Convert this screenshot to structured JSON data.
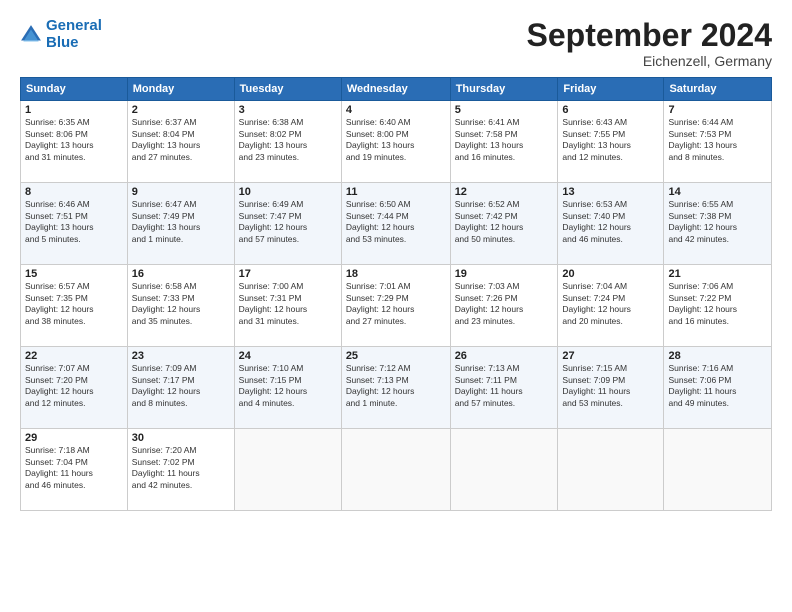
{
  "header": {
    "logo_line1": "General",
    "logo_line2": "Blue",
    "month": "September 2024",
    "location": "Eichenzell, Germany"
  },
  "weekdays": [
    "Sunday",
    "Monday",
    "Tuesday",
    "Wednesday",
    "Thursday",
    "Friday",
    "Saturday"
  ],
  "weeks": [
    [
      {
        "day": "1",
        "info": "Sunrise: 6:35 AM\nSunset: 8:06 PM\nDaylight: 13 hours\nand 31 minutes."
      },
      {
        "day": "2",
        "info": "Sunrise: 6:37 AM\nSunset: 8:04 PM\nDaylight: 13 hours\nand 27 minutes."
      },
      {
        "day": "3",
        "info": "Sunrise: 6:38 AM\nSunset: 8:02 PM\nDaylight: 13 hours\nand 23 minutes."
      },
      {
        "day": "4",
        "info": "Sunrise: 6:40 AM\nSunset: 8:00 PM\nDaylight: 13 hours\nand 19 minutes."
      },
      {
        "day": "5",
        "info": "Sunrise: 6:41 AM\nSunset: 7:58 PM\nDaylight: 13 hours\nand 16 minutes."
      },
      {
        "day": "6",
        "info": "Sunrise: 6:43 AM\nSunset: 7:55 PM\nDaylight: 13 hours\nand 12 minutes."
      },
      {
        "day": "7",
        "info": "Sunrise: 6:44 AM\nSunset: 7:53 PM\nDaylight: 13 hours\nand 8 minutes."
      }
    ],
    [
      {
        "day": "8",
        "info": "Sunrise: 6:46 AM\nSunset: 7:51 PM\nDaylight: 13 hours\nand 5 minutes."
      },
      {
        "day": "9",
        "info": "Sunrise: 6:47 AM\nSunset: 7:49 PM\nDaylight: 13 hours\nand 1 minute."
      },
      {
        "day": "10",
        "info": "Sunrise: 6:49 AM\nSunset: 7:47 PM\nDaylight: 12 hours\nand 57 minutes."
      },
      {
        "day": "11",
        "info": "Sunrise: 6:50 AM\nSunset: 7:44 PM\nDaylight: 12 hours\nand 53 minutes."
      },
      {
        "day": "12",
        "info": "Sunrise: 6:52 AM\nSunset: 7:42 PM\nDaylight: 12 hours\nand 50 minutes."
      },
      {
        "day": "13",
        "info": "Sunrise: 6:53 AM\nSunset: 7:40 PM\nDaylight: 12 hours\nand 46 minutes."
      },
      {
        "day": "14",
        "info": "Sunrise: 6:55 AM\nSunset: 7:38 PM\nDaylight: 12 hours\nand 42 minutes."
      }
    ],
    [
      {
        "day": "15",
        "info": "Sunrise: 6:57 AM\nSunset: 7:35 PM\nDaylight: 12 hours\nand 38 minutes."
      },
      {
        "day": "16",
        "info": "Sunrise: 6:58 AM\nSunset: 7:33 PM\nDaylight: 12 hours\nand 35 minutes."
      },
      {
        "day": "17",
        "info": "Sunrise: 7:00 AM\nSunset: 7:31 PM\nDaylight: 12 hours\nand 31 minutes."
      },
      {
        "day": "18",
        "info": "Sunrise: 7:01 AM\nSunset: 7:29 PM\nDaylight: 12 hours\nand 27 minutes."
      },
      {
        "day": "19",
        "info": "Sunrise: 7:03 AM\nSunset: 7:26 PM\nDaylight: 12 hours\nand 23 minutes."
      },
      {
        "day": "20",
        "info": "Sunrise: 7:04 AM\nSunset: 7:24 PM\nDaylight: 12 hours\nand 20 minutes."
      },
      {
        "day": "21",
        "info": "Sunrise: 7:06 AM\nSunset: 7:22 PM\nDaylight: 12 hours\nand 16 minutes."
      }
    ],
    [
      {
        "day": "22",
        "info": "Sunrise: 7:07 AM\nSunset: 7:20 PM\nDaylight: 12 hours\nand 12 minutes."
      },
      {
        "day": "23",
        "info": "Sunrise: 7:09 AM\nSunset: 7:17 PM\nDaylight: 12 hours\nand 8 minutes."
      },
      {
        "day": "24",
        "info": "Sunrise: 7:10 AM\nSunset: 7:15 PM\nDaylight: 12 hours\nand 4 minutes."
      },
      {
        "day": "25",
        "info": "Sunrise: 7:12 AM\nSunset: 7:13 PM\nDaylight: 12 hours\nand 1 minute."
      },
      {
        "day": "26",
        "info": "Sunrise: 7:13 AM\nSunset: 7:11 PM\nDaylight: 11 hours\nand 57 minutes."
      },
      {
        "day": "27",
        "info": "Sunrise: 7:15 AM\nSunset: 7:09 PM\nDaylight: 11 hours\nand 53 minutes."
      },
      {
        "day": "28",
        "info": "Sunrise: 7:16 AM\nSunset: 7:06 PM\nDaylight: 11 hours\nand 49 minutes."
      }
    ],
    [
      {
        "day": "29",
        "info": "Sunrise: 7:18 AM\nSunset: 7:04 PM\nDaylight: 11 hours\nand 46 minutes."
      },
      {
        "day": "30",
        "info": "Sunrise: 7:20 AM\nSunset: 7:02 PM\nDaylight: 11 hours\nand 42 minutes."
      },
      {
        "day": "",
        "info": ""
      },
      {
        "day": "",
        "info": ""
      },
      {
        "day": "",
        "info": ""
      },
      {
        "day": "",
        "info": ""
      },
      {
        "day": "",
        "info": ""
      }
    ]
  ]
}
